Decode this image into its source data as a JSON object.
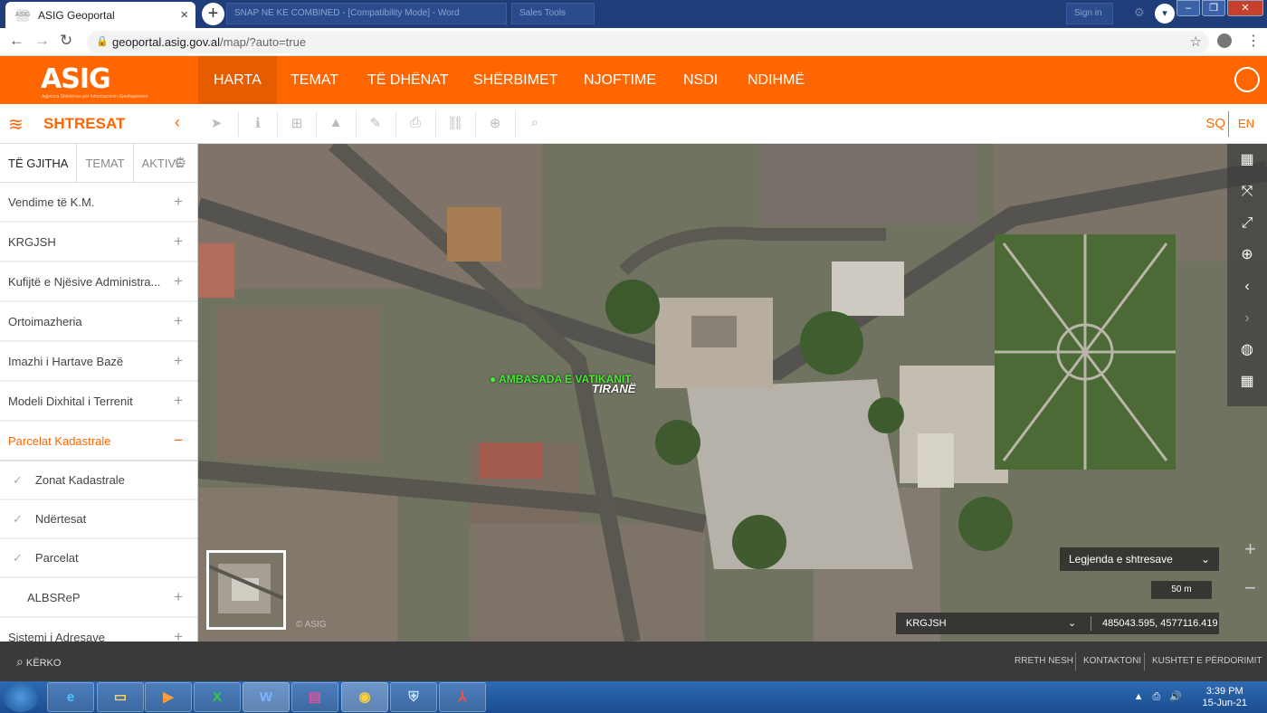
{
  "browser": {
    "tab_title": "ASIG Geoportal",
    "tab_close": "×",
    "new_tab": "+",
    "bg_tab1": "SNAP NE KE COMBINED - [Compatibility Mode] - Word",
    "bg_tab2": "Sales Tools",
    "bg_tab3": "Sign in",
    "url_host": "geoportal.asig.gov.al",
    "url_path": "/map/?auto=true"
  },
  "header": {
    "logo": "ASIG",
    "logo_sub": "Agjencia Shtetërore për Informacionin Gjeohapësinor",
    "menu": [
      "HARTA",
      "TEMAT",
      "TË DHËNAT",
      "SHËRBIMET",
      "NJOFTIME",
      "NSDI",
      "NDIHMË"
    ]
  },
  "toolbar": {
    "title": "SHTRESAT",
    "lang_sq": "SQ",
    "lang_en": "EN"
  },
  "sidebar": {
    "tabs": [
      "TË GJITHA",
      "TEMAT",
      "AKTIVE"
    ],
    "items": [
      {
        "label": "Vendime të K.M.",
        "sign": "+"
      },
      {
        "label": "KRGJSH",
        "sign": "+"
      },
      {
        "label": "Kufijtë e Njësive Administra...",
        "sign": "+"
      },
      {
        "label": "Ortoimazheria",
        "sign": "+"
      },
      {
        "label": "Imazhi i Hartave Bazë",
        "sign": "+"
      },
      {
        "label": "Modeli Dixhital i Terrenit",
        "sign": "+"
      },
      {
        "label": "Parcelat Kadastrale",
        "sign": "−"
      },
      {
        "label": "Zonat Kadastrale",
        "sign": ""
      },
      {
        "label": "Ndërtesat",
        "sign": ""
      },
      {
        "label": "Parcelat",
        "sign": ""
      },
      {
        "label": "ALBSReP",
        "sign": "+"
      },
      {
        "label": "Sistemi i Adresave",
        "sign": "+"
      }
    ]
  },
  "map": {
    "label_embassy": "AMBASADA E VATIKANIT",
    "label_city": "TIRANË",
    "legend": "Legjenda e shtresave",
    "scale": "50 m",
    "coord_system": "KRGJSH",
    "coordinates": "485043.595, 4577116.419",
    "copyright": "© ASIG"
  },
  "footer": {
    "search": "KËRKO",
    "links": [
      "RRETH NESH",
      "KONTAKTONI",
      "KUSHTET E PËRDORIMIT"
    ]
  },
  "taskbar": {
    "apps": [
      "IE",
      "Explorer",
      "Media",
      "Excel",
      "Word",
      "WinRAR",
      "Chrome",
      "Defender",
      "PDF"
    ],
    "time": "3:39 PM",
    "date": "15-Jun-21"
  },
  "colors": {
    "brand": "#ff6600",
    "header_active": "#e65c00"
  }
}
